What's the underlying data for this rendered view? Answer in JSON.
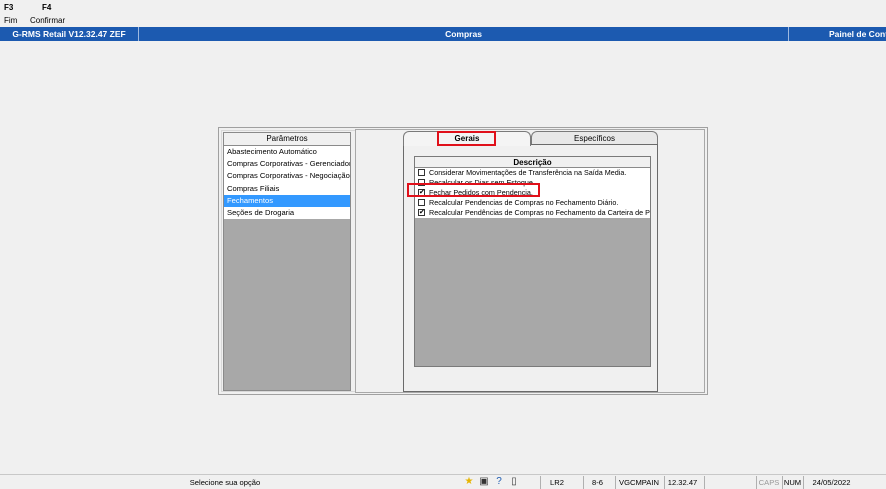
{
  "fkeys": [
    {
      "key": "F3",
      "label": "Fim"
    },
    {
      "key": "F4",
      "label": "Confirmar"
    }
  ],
  "titlebar": {
    "app": "G-RMS Retail V12.32.47 ZEF",
    "module": "Compras",
    "right": "Painel de Cont"
  },
  "params": {
    "header": "Parâmetros",
    "items": [
      "Abastecimento Automático",
      "Compras Corporativas - Gerenciador",
      "Compras Corporativas - Negociação",
      "Compras Filiais",
      "Fechamentos",
      "Seções de Drogaria"
    ],
    "selected": "Fechamentos"
  },
  "tabs": {
    "gerais": "Gerais",
    "especificos": "Específicos"
  },
  "grid": {
    "header": "Descrição",
    "rows": [
      {
        "checked": false,
        "text": "Considerar Movimentações de Transferência na Saída Media."
      },
      {
        "checked": false,
        "text": "Recalcular os Dias sem Estoque."
      },
      {
        "checked": true,
        "text": "Fechar Pedidos com Pendencia."
      },
      {
        "checked": false,
        "text": "Recalcular Pendencias de Compras no Fechamento Diário."
      },
      {
        "checked": true,
        "text": "Recalcular Pendências de Compras no Fechamento da Carteira de Pedidos"
      }
    ]
  },
  "status": {
    "message": "Selecione sua opção",
    "icons": [
      "star-icon",
      "user-settings-icon",
      "help-icon",
      "clipboard-icon"
    ],
    "lr": "LR2",
    "code": "8-6",
    "db": "VGCMPAIN",
    "version": "12.32.47",
    "caps": "CAPS",
    "num": "NUM",
    "date": "24/05/2022"
  },
  "colors": {
    "titlebar": "#1c5ab0",
    "selection": "#3399ff",
    "highlight": "#e0101a"
  }
}
